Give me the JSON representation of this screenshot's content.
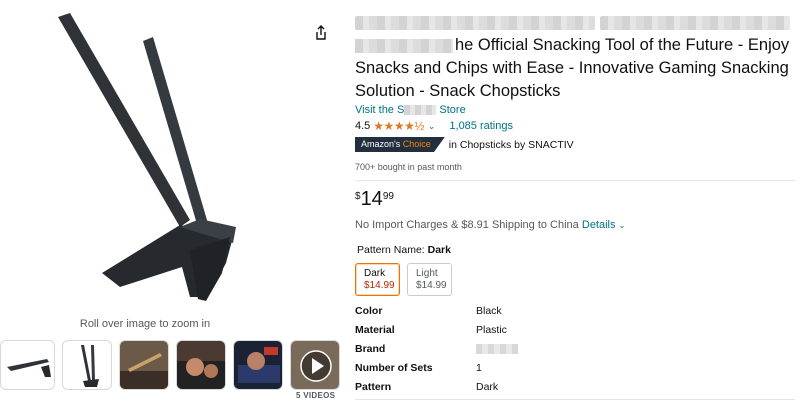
{
  "media": {
    "zoom_hint": "Roll over image to zoom in",
    "videos_label": "5 VIDEOS",
    "icons": [
      "share-icon",
      "play-icon"
    ]
  },
  "product": {
    "title": "he Official Snacking Tool of the Future - Enjoy Snacks and Chips with Ease - Innovative Gaming Snacking Solution - Snack Chopsticks",
    "store_prefix": "Visit the S",
    "store_suffix": "Store",
    "rating_value": "4.5",
    "stars": "★★★★½",
    "ratings_count": "1,085 ratings",
    "badge_prefix": "Amazon's",
    "badge_word": "Choice",
    "category_prefix": "in",
    "category_link": "Chopsticks by SNACTIV",
    "bought_text": "700+ bought in past month",
    "price_symbol": "$",
    "price_whole": "14",
    "price_fraction": "99",
    "shipping_text": "No Import Charges & $8.91 Shipping to China",
    "shipping_details": "Details",
    "pattern_name_label": "Pattern Name:",
    "pattern_selected": "Dark"
  },
  "swatches": [
    {
      "name": "Dark",
      "price": "$14.99",
      "selected": true
    },
    {
      "name": "Light",
      "price": "$14.99",
      "selected": false
    }
  ],
  "specs": [
    {
      "key": "Color",
      "value": "Black"
    },
    {
      "key": "Material",
      "value": "Plastic"
    },
    {
      "key": "Brand",
      "value": ""
    },
    {
      "key": "Number of Sets",
      "value": "1"
    },
    {
      "key": "Pattern",
      "value": "Dark"
    }
  ],
  "colors": {
    "link": "#007185",
    "star": "#de7921",
    "badge_bg": "#232f3e",
    "badge_accent": "#f08804",
    "price_red": "#b12704",
    "selected_border": "#e77600"
  }
}
